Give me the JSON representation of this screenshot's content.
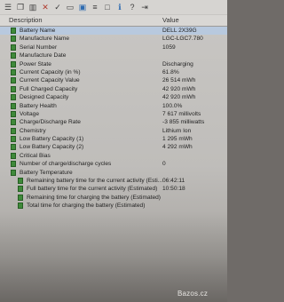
{
  "toolbar": {
    "buttons": [
      {
        "icon": "bars-icon"
      },
      {
        "icon": "copy-icon"
      },
      {
        "icon": "chart-icon"
      },
      {
        "icon": "close-icon"
      },
      {
        "icon": "check-icon"
      },
      {
        "icon": "folder-icon"
      },
      {
        "icon": "save-icon"
      },
      {
        "icon": "list-icon"
      },
      {
        "icon": "window-icon"
      },
      {
        "icon": "info-icon"
      },
      {
        "icon": "help-icon"
      },
      {
        "icon": "exit-icon"
      }
    ]
  },
  "table": {
    "headers": {
      "description": "Description",
      "value": "Value"
    },
    "rows": [
      {
        "label": "Battery Name",
        "value": "DELL 2X39G",
        "selected": true
      },
      {
        "label": "Manufacture Name",
        "value": "LGC-LGC7.780"
      },
      {
        "label": "Serial Number",
        "value": "1059"
      },
      {
        "label": "Manufacture Date",
        "value": ""
      },
      {
        "label": "Power State",
        "value": "Discharging"
      },
      {
        "label": "Current Capacity (in %)",
        "value": "61.8%"
      },
      {
        "label": "Current Capacity Value",
        "value": "26 514 mWh"
      },
      {
        "label": "Full Charged Capacity",
        "value": "42 920 mWh"
      },
      {
        "label": "Designed Capacity",
        "value": "42 920 mWh"
      },
      {
        "label": "Battery Health",
        "value": "100.0%"
      },
      {
        "label": "Voltage",
        "value": "7 617 millivolts"
      },
      {
        "label": "Charge/Discharge Rate",
        "value": "-3 855 milliwatts"
      },
      {
        "label": "Chemistry",
        "value": "Lithium Ion"
      },
      {
        "label": "Low Battery Capacity (1)",
        "value": "1 295 mWh"
      },
      {
        "label": "Low Battery Capacity (2)",
        "value": "4 292 mWh"
      },
      {
        "label": "Critical Bias",
        "value": ""
      },
      {
        "label": "Number of charge/discharge cycles",
        "value": "0"
      },
      {
        "label": "Battery Temperature",
        "value": ""
      },
      {
        "label": "Remaining battery time for the current activity (Esti...",
        "value": "06:42:11",
        "sub": true
      },
      {
        "label": "Full battery time for the current activity (Estimated)",
        "value": "10:50:18",
        "sub": true
      },
      {
        "label": "Remaining time for charging the battery (Estimated)",
        "value": "",
        "sub": true
      },
      {
        "label": "Total time for charging the battery (Estimated)",
        "value": "",
        "sub": true
      }
    ]
  },
  "watermark": "Bazos.cz"
}
